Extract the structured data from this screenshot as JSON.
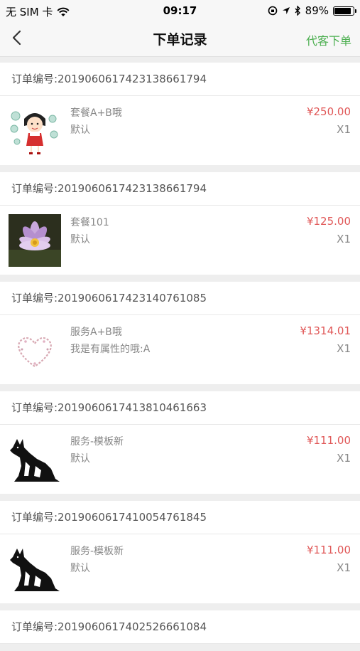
{
  "status_bar": {
    "carrier": "无 SIM 卡",
    "time": "09:17",
    "battery": "89%",
    "battery_level": 0.89
  },
  "nav": {
    "title": "下单记录",
    "right_action": "代客下单"
  },
  "orders": [
    {
      "header": "订单编号:2019060617423138661794",
      "item": {
        "name": "套餐A+B哦",
        "spec": "默认",
        "price": "¥250.00",
        "qty": "X1",
        "image": "cartoon-girl-image"
      }
    },
    {
      "header": "订单编号:2019060617423138661794",
      "item": {
        "name": "套餐101",
        "spec": "默认",
        "price": "¥125.00",
        "qty": "X1",
        "image": "lotus-flower-image"
      }
    },
    {
      "header": "订单编号:2019060617423140761085",
      "item": {
        "name": "服务A+B哦",
        "spec": "我是有属性的哦:A",
        "price": "¥1314.01",
        "qty": "X1",
        "image": "heart-wreath-image"
      }
    },
    {
      "header": "订单编号:2019060617413810461663",
      "item": {
        "name": "服务-模板新",
        "spec": "默认",
        "price": "¥111.00",
        "qty": "X1",
        "image": "dog-silhouette-image"
      }
    },
    {
      "header": "订单编号:2019060617410054761845",
      "item": {
        "name": "服务-模板新",
        "spec": "默认",
        "price": "¥111.00",
        "qty": "X1",
        "image": "dog-silhouette-image"
      }
    },
    {
      "header": "订单编号:2019060617402526661084"
    }
  ]
}
